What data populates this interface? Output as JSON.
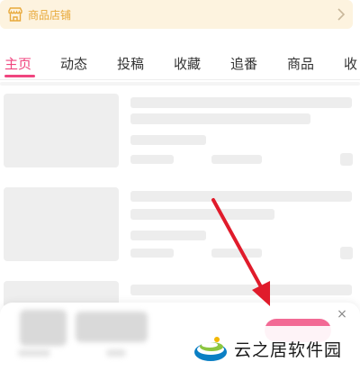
{
  "shop": {
    "label": "商品店铺"
  },
  "tabs": [
    {
      "label": "主页",
      "active": true
    },
    {
      "label": "动态"
    },
    {
      "label": "投稿"
    },
    {
      "label": "收藏"
    },
    {
      "label": "追番"
    },
    {
      "label": "商品"
    },
    {
      "label": "收"
    }
  ],
  "colors": {
    "accent": "#f0457f",
    "shop_bg": "#fdf3df",
    "shop_text": "#e8a93a",
    "arrow": "#e01b2b"
  },
  "popup": {
    "close_glyph": "×"
  },
  "watermark": {
    "text": "云之居软件园"
  }
}
